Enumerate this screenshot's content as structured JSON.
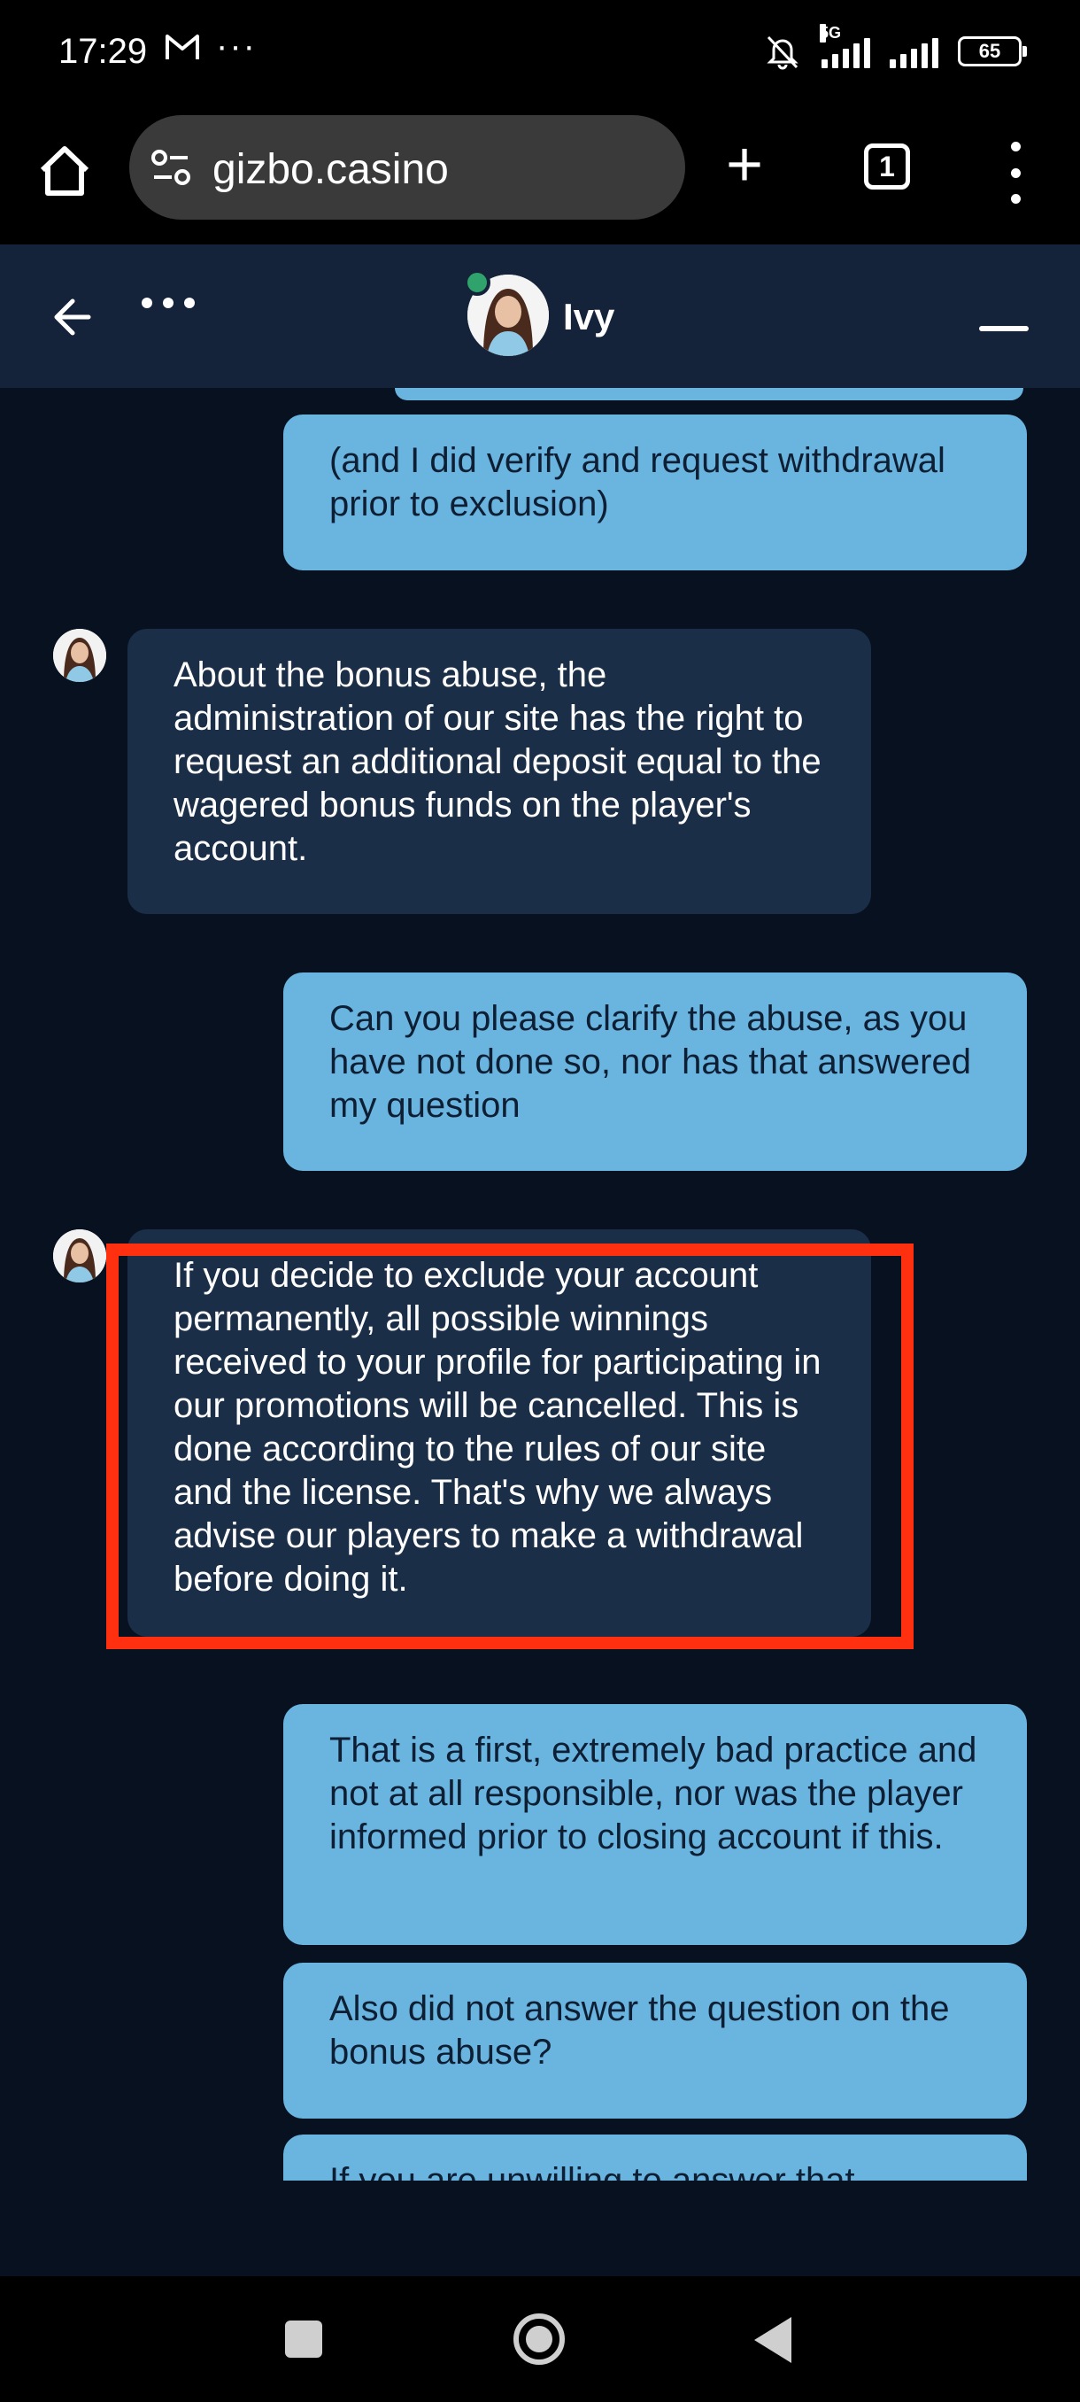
{
  "status_bar": {
    "time": "17:29",
    "mail_icon": "gmail-icon",
    "more_glyph": "···",
    "network_label": "5G",
    "battery_level": "65"
  },
  "browser": {
    "url": "gizbo.casino",
    "tab_count": "1",
    "plus_glyph": "+"
  },
  "chat": {
    "agent_name": "Ivy",
    "messages": [
      {
        "from": "user",
        "text": "(and I did verify and request withdrawal prior to exclusion)"
      },
      {
        "from": "agent",
        "text": "About the bonus abuse, the administration of our site has the right to request an additional deposit equal to the wagered bonus funds on the player's account."
      },
      {
        "from": "user",
        "text": "Can you please clarify the abuse, as you have not done so, nor has that answered my question"
      },
      {
        "from": "agent",
        "text": "If you decide to exclude your account permanently, all possible winnings received to your profile for participating in our promotions will be cancelled. This is done according to the rules of our site and the license. That's why we always advise our players to make a withdrawal before doing it."
      },
      {
        "from": "user",
        "text": "That is a first, extremely bad practice and not at all responsible, nor was the player informed prior to closing account if this."
      },
      {
        "from": "user",
        "text": "Also did not answer the question on the bonus abuse?"
      },
      {
        "from": "user",
        "text": "If you are unwilling to answer that"
      }
    ]
  },
  "colors": {
    "background": "#081120",
    "header": "#14233a",
    "agent_bubble": "#1b2e47",
    "user_bubble": "#6ab4e0",
    "highlight": "#ff3010",
    "online": "#2fa36b"
  }
}
